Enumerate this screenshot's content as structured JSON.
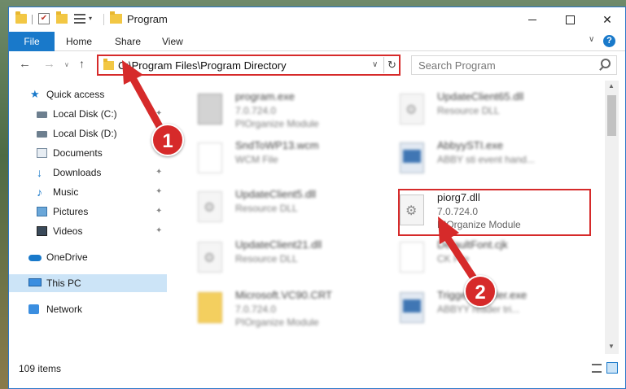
{
  "window": {
    "title": "Program",
    "props_icon_glyph": "✔",
    "qa_drop_glyph": "▾",
    "min_glyph": "",
    "max_glyph": "",
    "close_glyph": "✕"
  },
  "ribbon": {
    "file": "File",
    "home": "Home",
    "share": "Share",
    "view": "View",
    "chevron": "∨",
    "help": "?"
  },
  "nav": {
    "back": "←",
    "forward": "→",
    "recent": "∨",
    "up": "↑",
    "address": "C:\\Program Files\\Program Directory",
    "address_drop": "∨",
    "refresh": "↻",
    "search_placeholder": "Search Program"
  },
  "sidebar": {
    "pin": "✦",
    "items": [
      {
        "label": "Quick access",
        "icon": "star-icon",
        "glyph": "★"
      },
      {
        "label": "Local Disk (C:)",
        "icon": "disk-icon"
      },
      {
        "label": "Local Disk (D:)",
        "icon": "disk-icon"
      },
      {
        "label": "Documents",
        "icon": "documents-icon"
      },
      {
        "label": "Downloads",
        "icon": "download-icon",
        "glyph": "↓"
      },
      {
        "label": "Music",
        "icon": "music-icon",
        "glyph": "♪"
      },
      {
        "label": "Pictures",
        "icon": "pictures-icon"
      },
      {
        "label": "Videos",
        "icon": "videos-icon"
      },
      {
        "label": "OneDrive",
        "icon": "cloud-icon"
      },
      {
        "label": "This PC",
        "icon": "computer-icon"
      },
      {
        "label": "Network",
        "icon": "network-icon"
      }
    ]
  },
  "files": [
    {
      "name": "program.exe",
      "version": "7.0.724.0",
      "type": "PIOrganize Module",
      "icon": "exe-icon"
    },
    {
      "name": "UpdateClient65.dll",
      "version": "",
      "type": "Resource DLL",
      "icon": "dll-icon"
    },
    {
      "name": "SndToWP13.wcm",
      "version": "",
      "type": "WCM File",
      "icon": "file-icon"
    },
    {
      "name": "AbbyySTI.exe",
      "version": "",
      "type": "ABBY sti event hand...",
      "icon": "app-icon"
    },
    {
      "name": "UpdateClient5.dll",
      "version": "",
      "type": "Resource DLL",
      "icon": "dll-icon"
    },
    {
      "name": "piorg7.dll",
      "version": "7.0.724.0",
      "type": "PIOrganize Module",
      "icon": "dll-icon"
    },
    {
      "name": "UpdateClient21.dll",
      "version": "",
      "type": "Resource DLL",
      "icon": "dll-icon"
    },
    {
      "name": "DefaultFont.cjk",
      "version": "",
      "type": "CK File",
      "icon": "file-icon"
    },
    {
      "name": "Microsoft.VC90.CRT",
      "version": "7.0.724.0",
      "type": "PIOrganize Module",
      "icon": "folder-icon"
    },
    {
      "name": "TriggerInstaller.exe",
      "version": "",
      "type": "ABBYY reader tri...",
      "icon": "app-icon"
    }
  ],
  "status": {
    "count": "109 items"
  },
  "scroll": {
    "up": "▲",
    "down": "▼"
  },
  "annotations": {
    "step1": "1",
    "step2": "2",
    "color": "#d62a2a"
  },
  "colors": {
    "accent": "#1979ca",
    "highlight": "#d62a2a",
    "selected": "#cce4f7"
  }
}
